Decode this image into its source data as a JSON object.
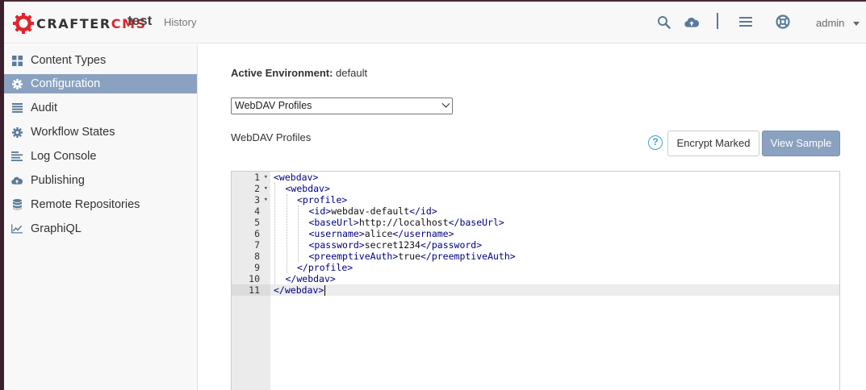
{
  "app": {
    "logo_part1": "CRAFTER",
    "logo_part2": "CMS",
    "site_name": "test",
    "history_label": "History",
    "user": "admin"
  },
  "toolbar": {
    "icons": [
      "search-icon",
      "cloud-upload-icon",
      "menu-icon",
      "help-lifebuoy-icon"
    ]
  },
  "sidebar": {
    "items": [
      {
        "label": "Content Types",
        "icon": "grid-icon",
        "active": false
      },
      {
        "label": "Configuration",
        "icon": "gear-icon",
        "active": true
      },
      {
        "label": "Audit",
        "icon": "list-icon",
        "active": false
      },
      {
        "label": "Workflow States",
        "icon": "gear-icon",
        "active": false
      },
      {
        "label": "Log Console",
        "icon": "align-left-icon",
        "active": false
      },
      {
        "label": "Publishing",
        "icon": "cloud-upload-icon",
        "active": false
      },
      {
        "label": "Remote Repositories",
        "icon": "database-icon",
        "active": false
      },
      {
        "label": "GraphiQL",
        "icon": "line-chart-icon",
        "active": false
      }
    ]
  },
  "main": {
    "env_label": "Active Environment:",
    "env_value": "default",
    "select_value": "WebDAV Profiles",
    "section_title": "WebDAV Profiles",
    "help_glyph": "?",
    "encrypt_button": "Encrypt Marked",
    "sample_button": "View Sample"
  },
  "editor": {
    "active_line": 11,
    "lines": [
      {
        "n": "1",
        "fold": true,
        "indent": 0,
        "parts": [
          [
            "tag",
            "<webdav>"
          ]
        ]
      },
      {
        "n": "2",
        "fold": true,
        "indent": 1,
        "parts": [
          [
            "tag",
            "<webdav>"
          ]
        ]
      },
      {
        "n": "3",
        "fold": true,
        "indent": 2,
        "parts": [
          [
            "tag",
            "<profile>"
          ]
        ]
      },
      {
        "n": "4",
        "fold": false,
        "indent": 3,
        "parts": [
          [
            "tag",
            "<id>"
          ],
          [
            "txt",
            "webdav-default"
          ],
          [
            "tag",
            "</id>"
          ]
        ]
      },
      {
        "n": "5",
        "fold": false,
        "indent": 3,
        "parts": [
          [
            "tag",
            "<baseUrl>"
          ],
          [
            "txt",
            "http://localhost"
          ],
          [
            "tag",
            "</baseUrl>"
          ]
        ]
      },
      {
        "n": "6",
        "fold": false,
        "indent": 3,
        "parts": [
          [
            "tag",
            "<username>"
          ],
          [
            "txt",
            "alice"
          ],
          [
            "tag",
            "</username>"
          ]
        ]
      },
      {
        "n": "7",
        "fold": false,
        "indent": 3,
        "parts": [
          [
            "tag",
            "<password>"
          ],
          [
            "txt",
            "secret1234"
          ],
          [
            "tag",
            "</password>"
          ]
        ]
      },
      {
        "n": "8",
        "fold": false,
        "indent": 3,
        "parts": [
          [
            "tag",
            "<preemptiveAuth>"
          ],
          [
            "txt",
            "true"
          ],
          [
            "tag",
            "</preemptiveAuth>"
          ]
        ]
      },
      {
        "n": "9",
        "fold": false,
        "indent": 2,
        "parts": [
          [
            "tag",
            "</profile>"
          ]
        ]
      },
      {
        "n": "10",
        "fold": false,
        "indent": 1,
        "parts": [
          [
            "tag",
            "</webdav>"
          ]
        ]
      },
      {
        "n": "11",
        "fold": false,
        "indent": 0,
        "parts": [
          [
            "tag",
            "</webdav>"
          ]
        ]
      }
    ]
  },
  "colors": {
    "accent": "#8aa2c0",
    "icon": "#5b7a9a",
    "logo_red": "#e2232a",
    "xml_tag": "#000080",
    "help": "#3aa3d9"
  }
}
